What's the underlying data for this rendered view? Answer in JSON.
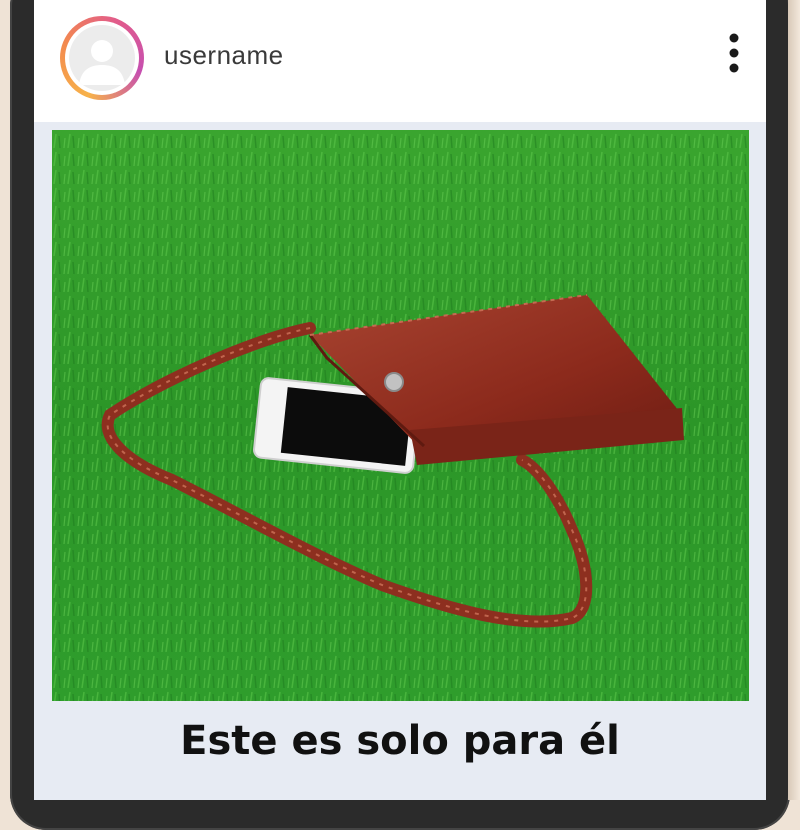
{
  "post": {
    "username": "username",
    "caption": "Este es solo para él"
  },
  "icons": {
    "avatar": "default-avatar-icon",
    "more": "more-vertical-icon"
  },
  "colors": {
    "avatar_ring": [
      "#f7b24a",
      "#e25c8a",
      "#c64fb0"
    ],
    "grass": "#2f9a2c",
    "bag": "#8c2a1c",
    "caption_background": "#e7ebf3"
  }
}
